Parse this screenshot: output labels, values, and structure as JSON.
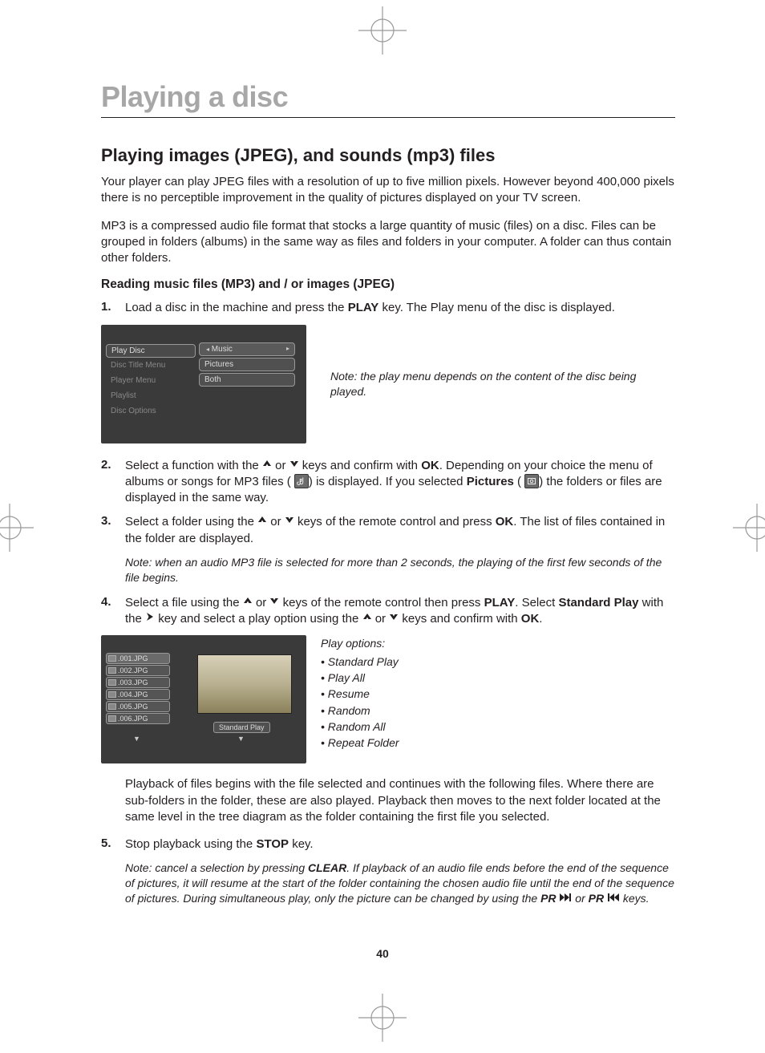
{
  "page": {
    "title": "Playing a disc",
    "section_heading": "Playing images (JPEG), and sounds (mp3) files",
    "intro_p1": "Your player can play JPEG files with a resolution of up to five million pixels. However beyond 400,000 pixels there is no perceptible improvement in the quality of pictures displayed on your TV screen.",
    "intro_p2": "MP3 is a compressed audio file format that stocks a large quantity of music (files) on a disc. Files can be grouped in folders (albums) in the same way as files and folders in your computer. A folder can thus contain other folders.",
    "subheading": "Reading music files (MP3) and / or images (JPEG)",
    "page_number": "40"
  },
  "steps": {
    "s1": {
      "num": "1.",
      "pre": "Load a disc in the machine and press the ",
      "play": "PLAY",
      "post": " key. The Play menu of the disc is displayed."
    },
    "s2": {
      "num": "2.",
      "a": "Select a function with the ",
      "b": " or ",
      "c": " keys and confirm with ",
      "ok": "OK",
      "d": ". Depending on your choice the menu of albums or songs for MP3 files (",
      "e": ") is displayed. If you selected ",
      "pictures": "Pictures",
      "f": " (",
      "g": ") the folders or files are displayed in the same way."
    },
    "s3": {
      "num": "3.",
      "a": "Select a folder using the ",
      "b": " or ",
      "c": " keys of the remote control and press ",
      "ok": "OK",
      "d": ". The list of files contained in the folder are displayed.",
      "note": "Note: when an audio MP3 file is selected for more than 2 seconds, the playing of the first few seconds of the file begins."
    },
    "s4": {
      "num": "4.",
      "a": "Select a file using the ",
      "b": " or ",
      "c": " keys of the remote control then press ",
      "play": "PLAY",
      "d": ". Select ",
      "std": "Standard Play",
      "e": " with the ",
      "f": " key and select a play option using the ",
      "g": " or ",
      "h": " keys and confirm with ",
      "ok": "OK",
      "i": "."
    },
    "s4_after": "Playback of files begins with the file selected and continues with the following files. Where there are sub-folders in the folder, these are also played. Playback then moves to the next folder located at the same level in the tree diagram as the folder containing the first file you selected.",
    "s5": {
      "num": "5.",
      "a": "Stop playback using the ",
      "stop": "STOP",
      "b": " key.",
      "note_a": "Note: cancel a selection by pressing ",
      "clear": "CLEAR",
      "note_b": ". If playback of an audio file ends before the end of the sequence of pictures, it will resume at the start of the folder containing the chosen audio file until the end of the sequence of pictures. During simultaneous play, only the picture can be changed by using the ",
      "pr1": "PR",
      "note_c": " or ",
      "pr2": "PR",
      "note_d": " keys."
    }
  },
  "fig1": {
    "note": "Note: the play menu depends on the content of the disc being played.",
    "menu": [
      "Play Disc",
      "Disc Title Menu",
      "Player Menu",
      "Playlist",
      "Disc Options"
    ],
    "sub": [
      "Music",
      "Pictures",
      "Both"
    ]
  },
  "fig2": {
    "files": [
      ".001.JPG",
      ".002.JPG",
      ".003.JPG",
      ".004.JPG",
      ".005.JPG",
      ".006.JPG"
    ],
    "standard_play": "Standard Play"
  },
  "play_options": {
    "heading": "Play options:",
    "items": [
      "Standard Play",
      "Play All",
      "Resume",
      "Random",
      "Random All",
      "Repeat Folder"
    ]
  }
}
